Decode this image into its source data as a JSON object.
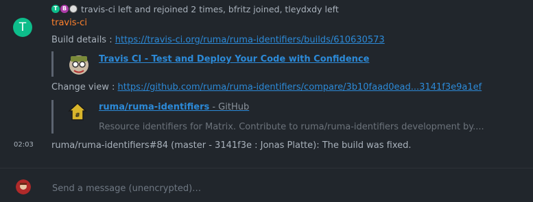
{
  "membership": {
    "avatars": [
      "T",
      "B",
      ""
    ],
    "text": "travis-ci left and rejoined 2 times, bfritz joined, tleydxdy left"
  },
  "sender": {
    "initial": "T",
    "name": "travis-ci"
  },
  "build_details": {
    "label": "Build details : ",
    "url": "https://travis-ci.org/ruma/ruma-identifiers/builds/610630573"
  },
  "preview1": {
    "title": "Travis CI - Test and Deploy Your Code with Confidence"
  },
  "change_view": {
    "label": "Change view : ",
    "url": "https://github.com/ruma/ruma-identifiers/compare/3b10faad0ead...3141f3e9a1ef"
  },
  "preview2": {
    "title": "ruma/ruma-identifiers",
    "site": " - GitHub",
    "description": "Resource identifiers for Matrix. Contribute to ruma/ruma-identifiers development by...."
  },
  "status_message": {
    "time": "02:03",
    "text": "ruma/ruma-identifiers#84 (master - 3141f3e : Jonas Platte): The build was fixed."
  },
  "composer": {
    "placeholder": "Send a message (unencrypted)…"
  },
  "colors": {
    "background": "#21262c",
    "accent_green": "#0dbd8b",
    "sender_orange": "#ff812d",
    "link_blue": "#2c8ad8"
  }
}
